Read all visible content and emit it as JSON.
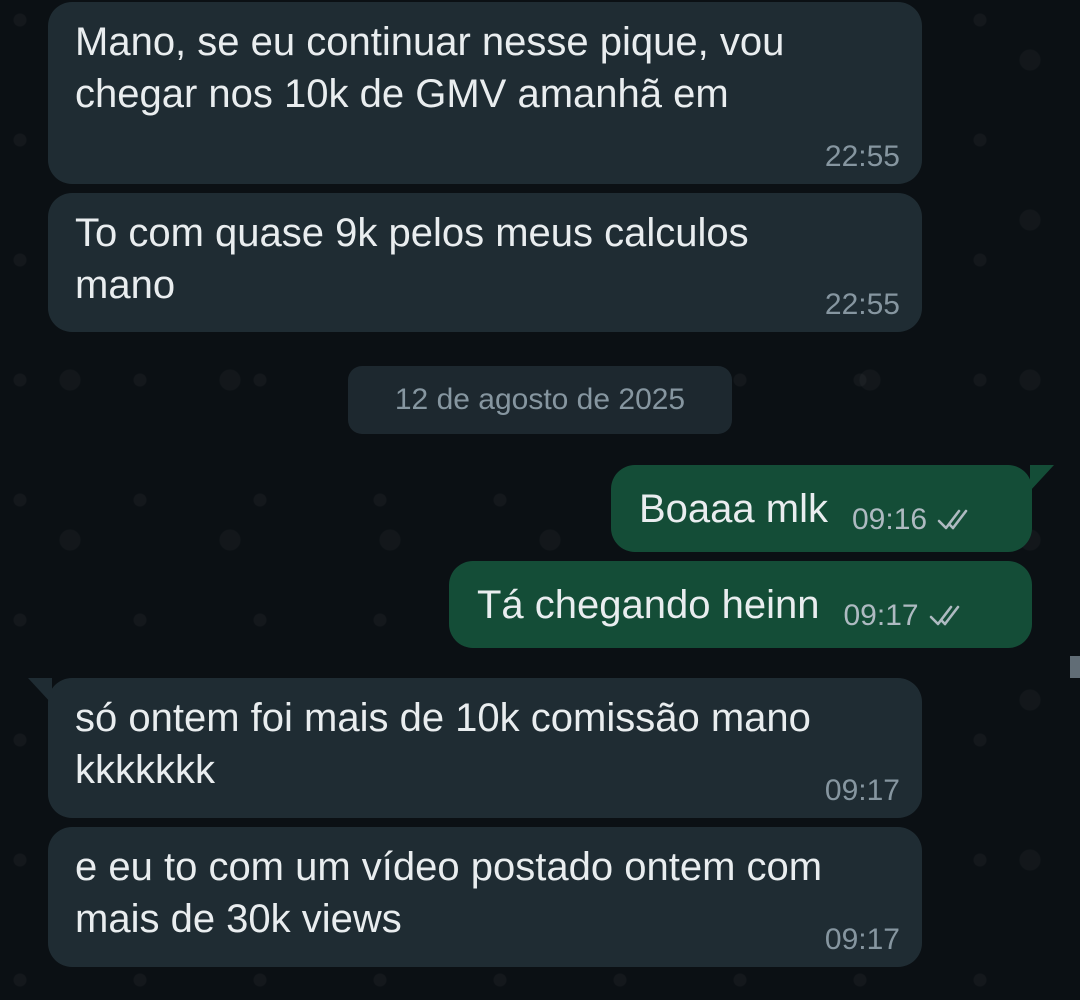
{
  "messages": [
    {
      "direction": "in",
      "text": "Mano, se eu continuar nesse pique, vou chegar nos 10k de GMV amanhã em",
      "time": "22:55"
    },
    {
      "direction": "in",
      "text": "To com quase 9k pelos meus calculos mano",
      "time": "22:55"
    },
    {
      "direction": "out",
      "text": "Boaaa mlk",
      "time": "09:16",
      "status_icon": "double-check-read"
    },
    {
      "direction": "out",
      "text": "Tá chegando heinn",
      "time": "09:17",
      "status_icon": "double-check-read"
    },
    {
      "direction": "in",
      "text": "só ontem foi mais de 10k comissão mano kkkkkkk",
      "time": "09:17"
    },
    {
      "direction": "in",
      "text": "e eu to com um vídeo postado ontem com mais de 30k views",
      "time": "09:17"
    }
  ],
  "date_separator": "12 de agosto de 2025",
  "colors": {
    "background": "#0b1014",
    "incoming_bubble": "#1f2c33",
    "outgoing_bubble": "#144d37",
    "text": "#e9edef",
    "timestamp": "#8696a0",
    "check": "#aebac1"
  }
}
